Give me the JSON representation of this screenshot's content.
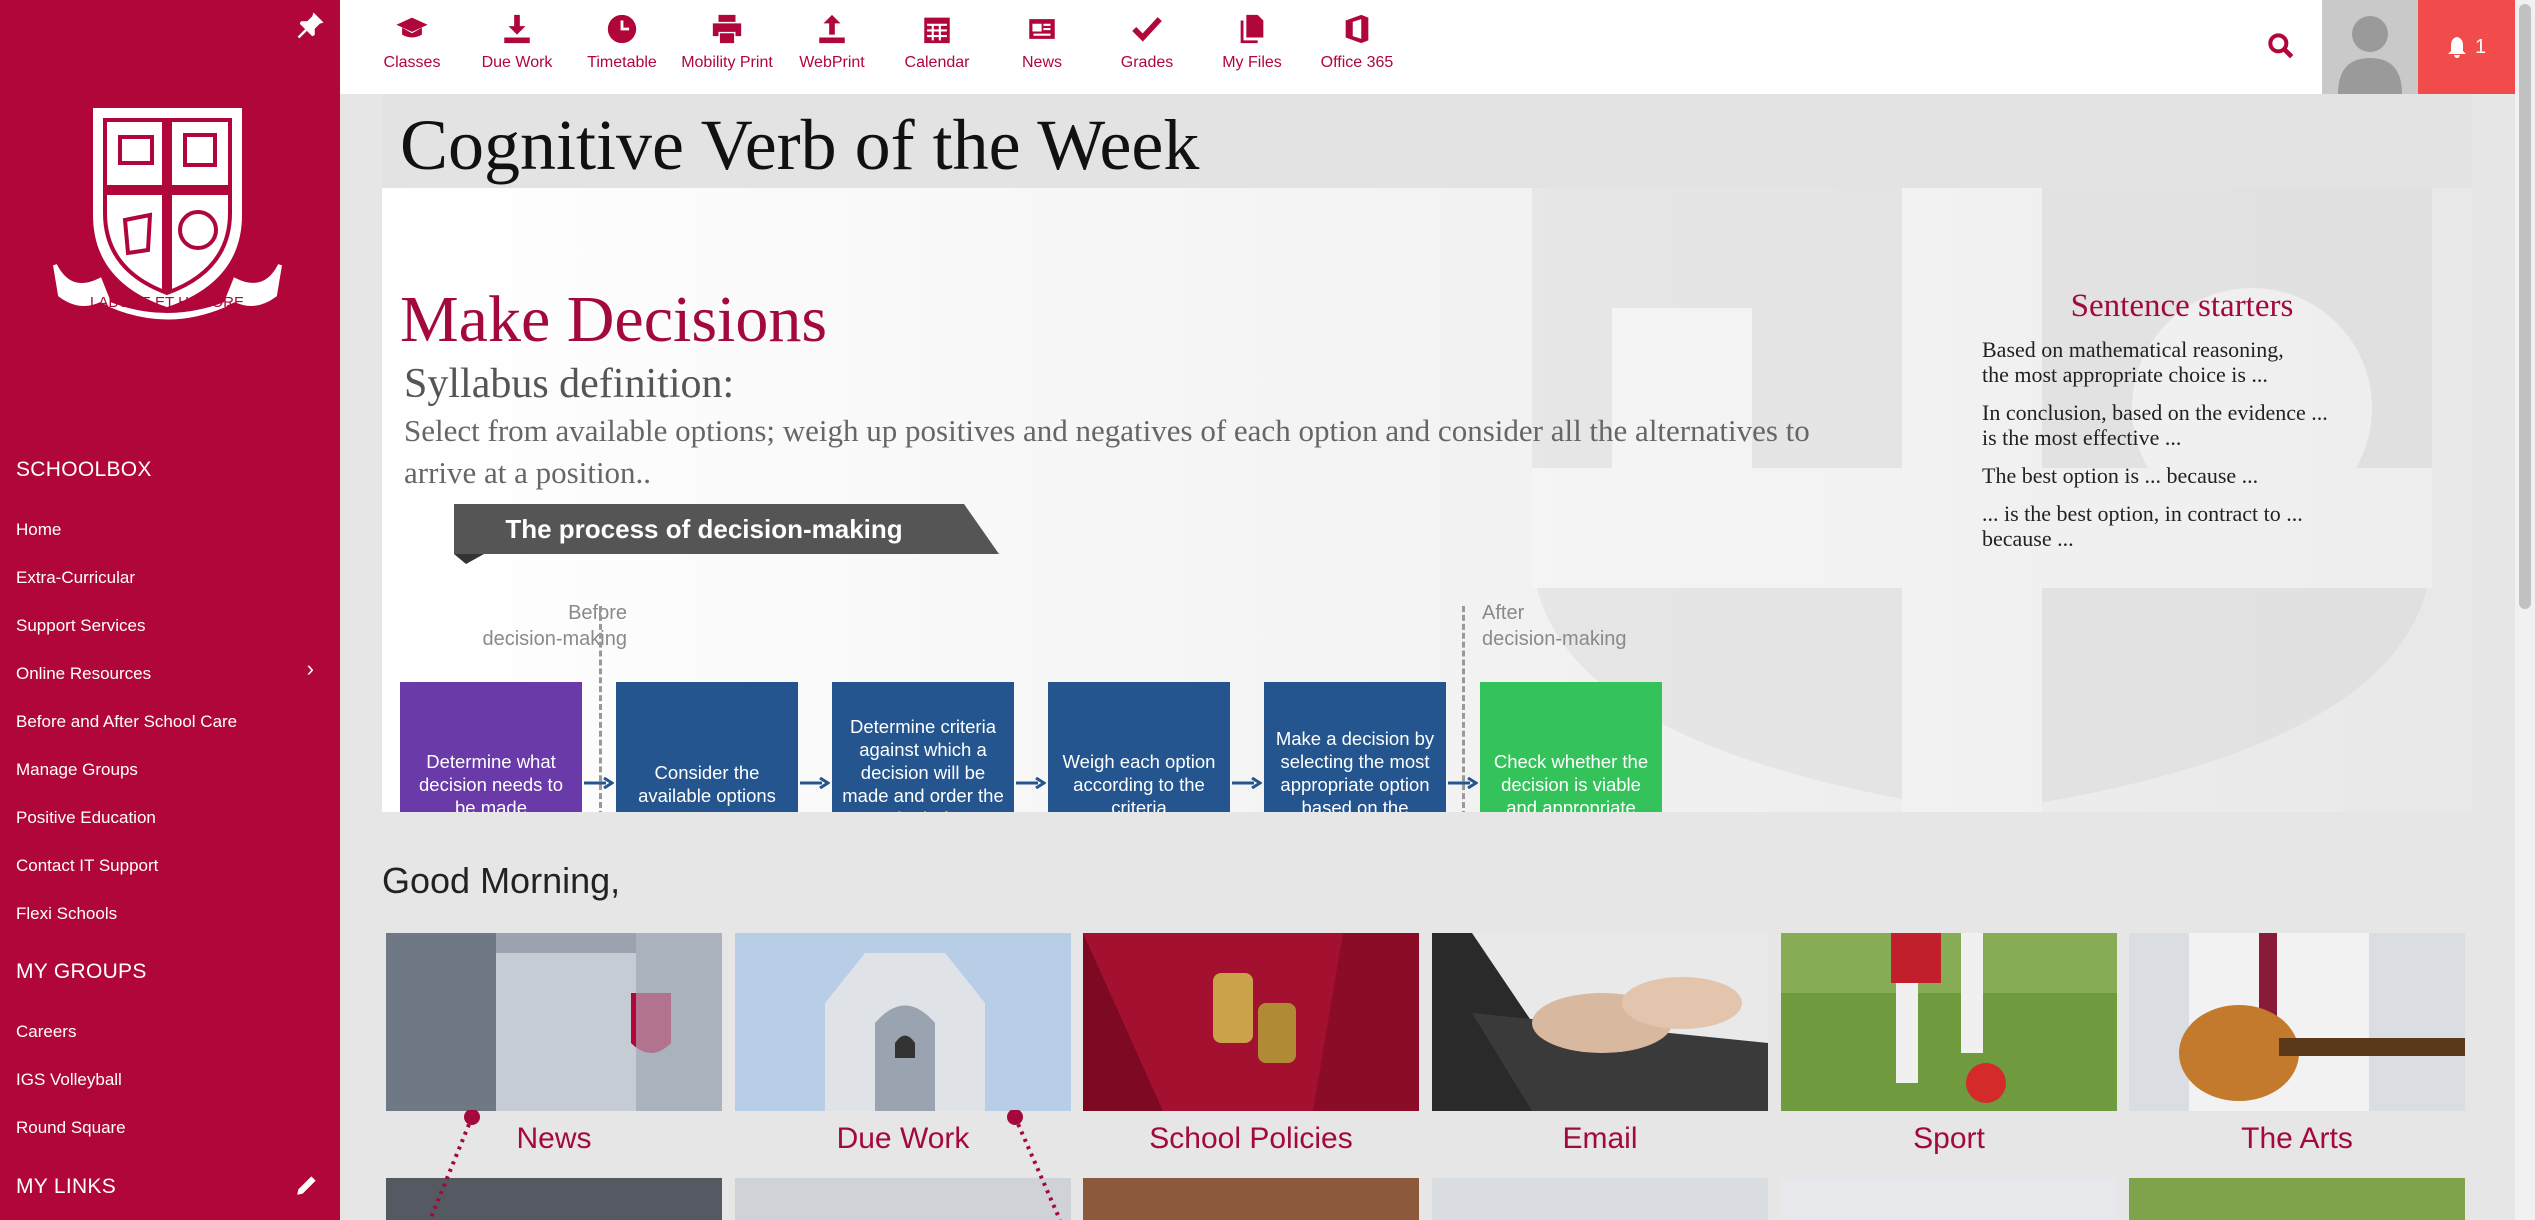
{
  "sidebar": {
    "sections": [
      "SCHOOLBOX",
      "MY GROUPS",
      "MY LINKS"
    ],
    "schoolbox_items": [
      "Home",
      "Extra-Curricular",
      "Support Services",
      "Online Resources",
      "Before and After School Care",
      "Manage Groups",
      "Positive Education",
      "Contact IT Support",
      "Flexi Schools"
    ],
    "group_items": [
      "Careers",
      "IGS Volleyball",
      "Round Square"
    ],
    "logo_motto": "LABORE ET HONORE",
    "icons": [
      "pin-icon",
      "chevron-right-icon",
      "pencil-icon"
    ]
  },
  "topnav": {
    "items": [
      "Classes",
      "Due Work",
      "Timetable",
      "Mobility Print",
      "WebPrint",
      "Calendar",
      "News",
      "Grades",
      "My Files",
      "Office 365"
    ],
    "notification_count": "1",
    "icons": [
      "graduation-cap-icon",
      "download-icon",
      "clock-icon",
      "printer-icon",
      "upload-icon",
      "calendar-icon",
      "newspaper-icon",
      "check-icon",
      "files-icon",
      "office-icon",
      "search-icon",
      "bell-icon"
    ]
  },
  "banner": {
    "title": "Cognitive Verb of the Week",
    "verb": "Make Decisions",
    "syllabus_heading": "Syllabus definition:",
    "syllabus_text": "Select from available options; weigh up positives and negatives of each option and consider all the alternatives to arrive at a position..",
    "process_title": "The process of decision-making",
    "before_label_1": "Before",
    "before_label_2": "decision-making",
    "after_label_1": "After",
    "after_label_2": "decision-making",
    "steps": [
      "Determine what decision needs to be made",
      "Consider the available options",
      "Determine criteria against which a decision will be made and order the criteria for importance",
      "Weigh each option according to the criteria",
      "Make a decision by selecting the most appropriate option based on the evaluation",
      "Check whether the decision is viable and appropriate"
    ],
    "step_colors": [
      "#6a3aa8",
      "#24558f",
      "#24558f",
      "#24558f",
      "#24558f",
      "#33c35a"
    ],
    "starters_title": "Sentence starters",
    "starters": [
      [
        "Based on mathematical reasoning,",
        "the most appropriate choice is ..."
      ],
      [
        "In conclusion, based on the evidence ...",
        "is the most effective ..."
      ],
      [
        "The best option is ... because ..."
      ],
      [
        "... is the best option, in contract to ...",
        "because ..."
      ]
    ]
  },
  "greeting": "Good Morning,",
  "tiles": [
    "News",
    "Due Work",
    "School Policies",
    "Email",
    "Sport",
    "The Arts"
  ],
  "colors": {
    "brand": "#b0063a",
    "notification": "#f24b4b",
    "verb_text": "#a3093c"
  }
}
